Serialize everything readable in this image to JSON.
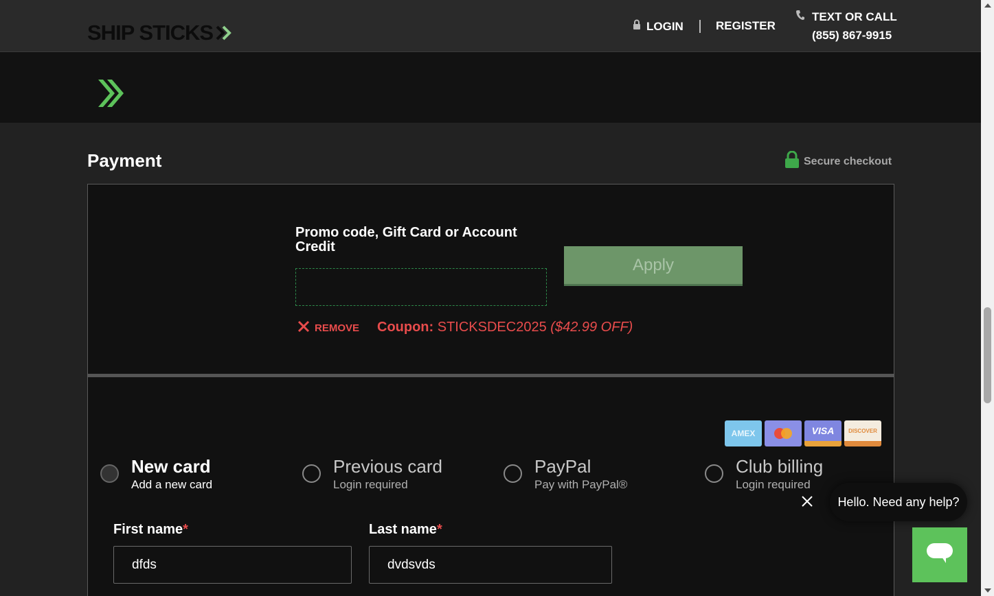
{
  "header": {
    "logo_text": "SHIP STICKS",
    "login_label": "LOGIN",
    "register_label": "REGISTER",
    "call_label": "TEXT OR CALL",
    "phone": "(855) 867-9915"
  },
  "payment": {
    "title": "Payment",
    "secure_label": "Secure checkout"
  },
  "promo": {
    "label": "Promo code, Gift Card or Account Credit",
    "input_value": "",
    "apply_label": "Apply",
    "remove_label": "REMOVE",
    "coupon_prefix": "Coupon:",
    "coupon_code": "STICKSDEC2025",
    "coupon_discount": "($42.99 OFF)"
  },
  "card_brands": {
    "amex": "AMEX",
    "visa": "VISA",
    "discover": "DISCOVER"
  },
  "payment_options": [
    {
      "title": "New card",
      "subtitle": "Add a new card",
      "selected": true
    },
    {
      "title": "Previous card",
      "subtitle": "Login required",
      "selected": false
    },
    {
      "title": "PayPal",
      "subtitle": "Pay with PayPal®",
      "selected": false
    },
    {
      "title": "Club billing",
      "subtitle": "Login required",
      "selected": false
    }
  ],
  "form": {
    "first_name_label": "First name",
    "first_name_value": "dfds",
    "last_name_label": "Last name",
    "last_name_value": "dvdsvds",
    "required_mark": "*"
  },
  "chat": {
    "greeting": "Hello. Need any help?"
  },
  "colors": {
    "brand_green": "#5dc25b",
    "error_red": "#e84c4c",
    "apply_green": "#6d9669"
  }
}
